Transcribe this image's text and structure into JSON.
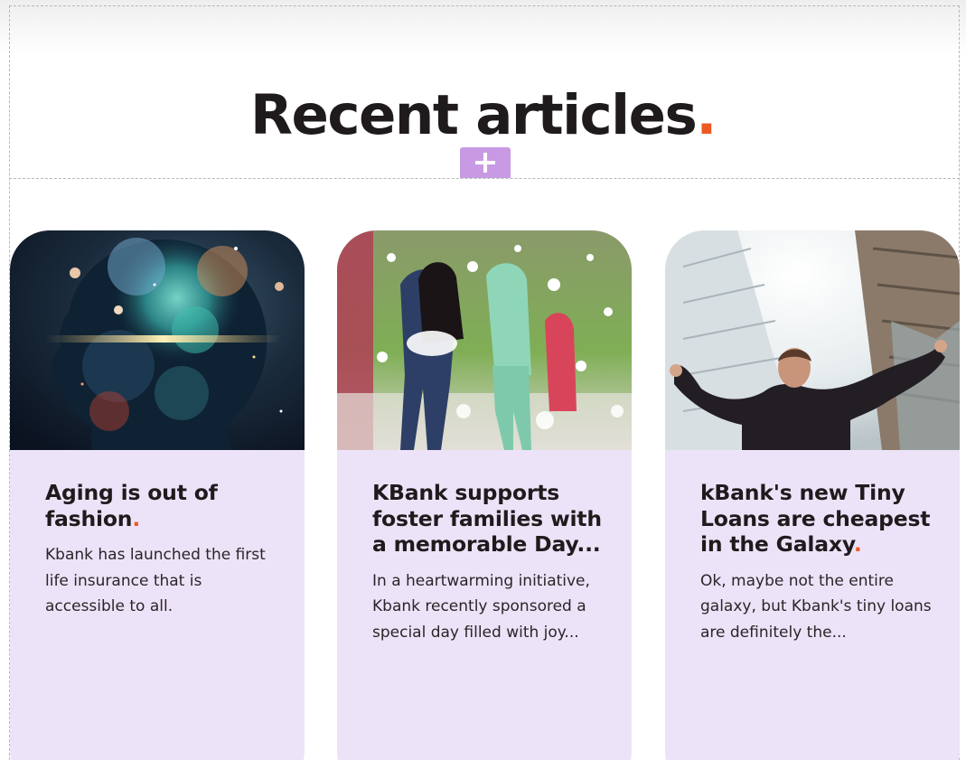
{
  "section": {
    "title": "Recent articles",
    "title_accent": ".",
    "accent_color": "#ee5a24",
    "add_block_icon": "plus-icon"
  },
  "articles": [
    {
      "title": "Aging is out of fashion",
      "title_accent": ".",
      "excerpt": "Kbank has launched the first life insurance that is accessible to all.",
      "image": "cosmic-head-silhouette"
    },
    {
      "title": "KBank supports foster families with a memorable Day...",
      "title_accent": "",
      "excerpt": "In a heartwarming initiative, Kbank recently sponsored a special day filled with joy...",
      "image": "children-playing-in-foam"
    },
    {
      "title": "kBank's new Tiny Loans are cheapest in the Galaxy",
      "title_accent": ".",
      "excerpt": "Ok, maybe not the entire galaxy, but Kbank's tiny loans are definitely the...",
      "image": "businessman-arms-raised-skyscrapers"
    }
  ],
  "colors": {
    "card_background": "#ede3f8",
    "add_button": "#c89ae3",
    "text": "#1f1b1d"
  }
}
